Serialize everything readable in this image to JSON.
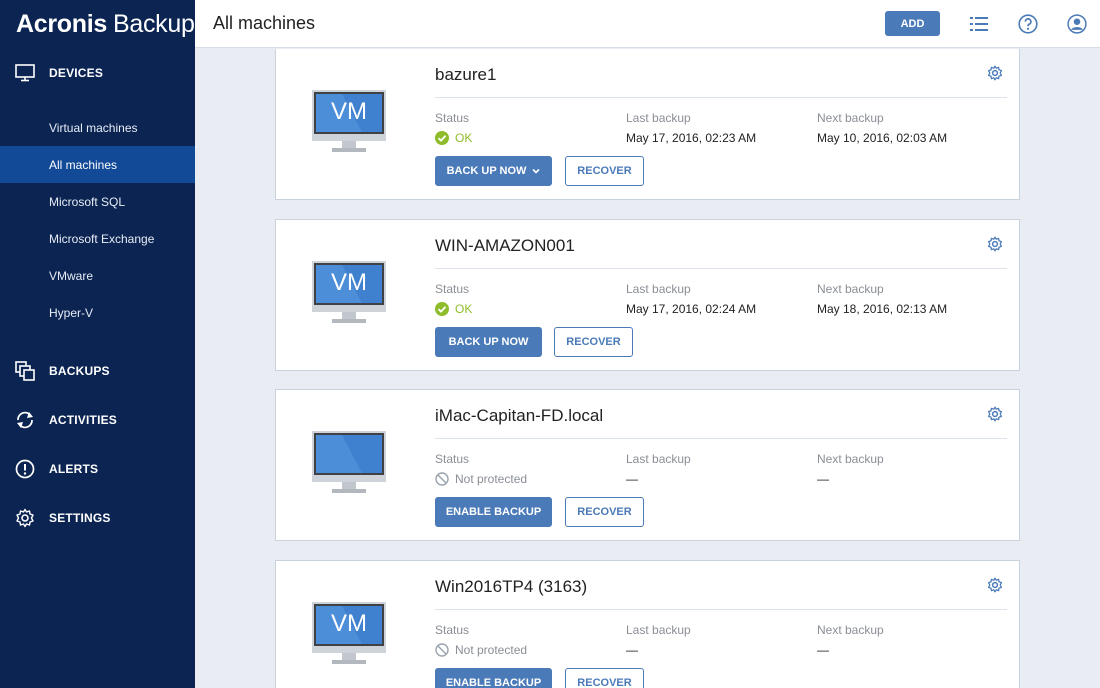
{
  "app": {
    "brand": "Acronis",
    "product": "Backup"
  },
  "sidebar": {
    "groups": [
      {
        "label": "DEVICES",
        "icon": "monitor-icon"
      },
      {
        "label": "BACKUPS",
        "icon": "backups-icon"
      },
      {
        "label": "ACTIVITIES",
        "icon": "activities-icon"
      },
      {
        "label": "ALERTS",
        "icon": "alert-icon"
      },
      {
        "label": "SETTINGS",
        "icon": "gear-icon"
      }
    ],
    "devices_items": [
      {
        "label": "Virtual machines"
      },
      {
        "label": "All machines",
        "active": true
      },
      {
        "label": "Microsoft SQL"
      },
      {
        "label": "Microsoft Exchange"
      },
      {
        "label": "VMware"
      },
      {
        "label": "Hyper-V"
      }
    ]
  },
  "header": {
    "title": "All machines",
    "add_label": "ADD",
    "icons": [
      "list-icon",
      "help-icon",
      "account-icon"
    ]
  },
  "labels": {
    "status": "Status",
    "last_backup": "Last backup",
    "next_backup": "Next backup",
    "recover": "RECOVER"
  },
  "machines": [
    {
      "name": "bazure1",
      "vm_label": "VM",
      "status": "OK",
      "last_backup": "May 17, 2016, 02:23 AM",
      "next_backup": "May 10, 2016, 02:03 AM",
      "primary_action": "BACK UP NOW"
    },
    {
      "name": "WIN-AMAZON001",
      "vm_label": "VM",
      "status": "OK",
      "last_backup": "May 17, 2016, 02:24 AM",
      "next_backup": "May 18, 2016, 02:13 AM",
      "primary_action": "BACK UP NOW"
    },
    {
      "name": "iMac-Capitan-FD.local",
      "vm_label": "",
      "status": "Not protected",
      "last_backup": "—",
      "next_backup": "—",
      "primary_action": "ENABLE BACKUP"
    },
    {
      "name": "Win2016TP4 (3163)",
      "vm_label": "VM",
      "status": "Not protected",
      "last_backup": "—",
      "next_backup": "—",
      "primary_action": "ENABLE BACKUP"
    }
  ],
  "colors": {
    "sidebar_bg": "#0b2452",
    "sidebar_active": "#124a97",
    "accent": "#4a7ab8",
    "ok_green": "#8fbc2b"
  }
}
